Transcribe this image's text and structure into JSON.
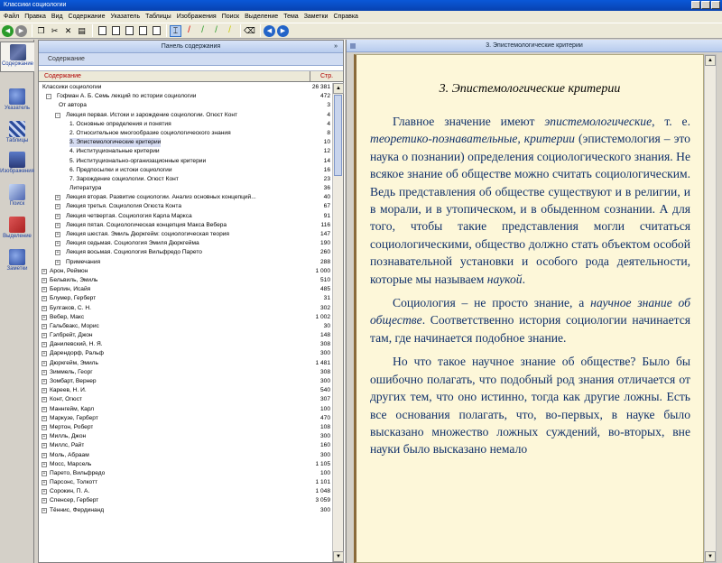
{
  "window": {
    "title": "Классики социологии"
  },
  "menu": [
    "Файл",
    "Правка",
    "Вид",
    "Содержание",
    "Указатель",
    "Таблицы",
    "Изображения",
    "Поиск",
    "Выделение",
    "Тема",
    "Заметки",
    "Справка"
  ],
  "nav": [
    {
      "label": "Содержание",
      "icon": "book-icon",
      "cls": "book",
      "active": true
    },
    {
      "label": "Указатель",
      "icon": "index-icon",
      "cls": "blue",
      "active": false
    },
    {
      "label": "Таблицы",
      "icon": "table-icon",
      "cls": "chk",
      "active": false
    },
    {
      "label": "Изображения",
      "icon": "image-icon",
      "cls": "pic",
      "active": false
    },
    {
      "label": "Поиск",
      "icon": "search-icon",
      "cls": "pen",
      "active": false
    },
    {
      "label": "Выделение",
      "icon": "highlight-icon",
      "cls": "sel",
      "active": false
    },
    {
      "label": "Заметки",
      "icon": "notes-icon",
      "cls": "blue",
      "active": false
    }
  ],
  "contents": {
    "header": "Панель содержания",
    "subheader": "Содержание",
    "col_title": "Содержание",
    "col_page": "Стр.",
    "rows": [
      {
        "t": "Классики социологии",
        "p": "26 381",
        "lvl": 0,
        "exp": ""
      },
      {
        "t": "Гофман А. Б. Семь лекций по истории социологии",
        "p": "472",
        "lvl": 1,
        "exp": "-"
      },
      {
        "t": "От автора",
        "p": "3",
        "lvl": 2,
        "exp": ""
      },
      {
        "t": "Лекция первая. Истоки и зарождение социологии. Огюст Конт",
        "p": "4",
        "lvl": 2,
        "exp": "-"
      },
      {
        "t": "1. Основные определения и понятия",
        "p": "4",
        "lvl": 3,
        "exp": ""
      },
      {
        "t": "2. Относительное многообразие социологического знания",
        "p": "8",
        "lvl": 3,
        "exp": ""
      },
      {
        "t": "3. Эпистемологические критерии",
        "p": "10",
        "lvl": 3,
        "exp": "",
        "hl": true
      },
      {
        "t": "4. Институциональные критерии",
        "p": "12",
        "lvl": 3,
        "exp": ""
      },
      {
        "t": "5. Институционально-организационные критерии",
        "p": "14",
        "lvl": 3,
        "exp": ""
      },
      {
        "t": "6. Предпосылки и истоки социологии",
        "p": "16",
        "lvl": 3,
        "exp": ""
      },
      {
        "t": "7. Зарождение социологии. Огюст Конт",
        "p": "23",
        "lvl": 3,
        "exp": ""
      },
      {
        "t": "Литература",
        "p": "36",
        "lvl": 3,
        "exp": ""
      },
      {
        "t": "Лекция вторая. Развитие социологии. Анализ основных концепций...",
        "p": "40",
        "lvl": 2,
        "exp": "+"
      },
      {
        "t": "Лекция третья. Социология Огюста Конта",
        "p": "67",
        "lvl": 2,
        "exp": "+"
      },
      {
        "t": "Лекция четвертая. Социология Карла Маркса",
        "p": "91",
        "lvl": 2,
        "exp": "+"
      },
      {
        "t": "Лекция пятая. Социологическая концепция Макса Вебера",
        "p": "116",
        "lvl": 2,
        "exp": "+"
      },
      {
        "t": "Лекция шестая. Эмиль Дюркгейм: социологическая теория",
        "p": "147",
        "lvl": 2,
        "exp": "+"
      },
      {
        "t": "Лекция седьмая. Социология Эмиля Дюркгейма",
        "p": "190",
        "lvl": 2,
        "exp": "+"
      },
      {
        "t": "Лекция восьмая. Социология Вильфредо Парето",
        "p": "260",
        "lvl": 2,
        "exp": "+"
      },
      {
        "t": "Примечания",
        "p": "288",
        "lvl": 2,
        "exp": "+"
      },
      {
        "t": "Арон, Реймон",
        "p": "1 000",
        "lvl": 0,
        "exp": "+"
      },
      {
        "t": "Бельвиль, Эмиль",
        "p": "510",
        "lvl": 0,
        "exp": "+"
      },
      {
        "t": "Берлин, Исайя",
        "p": "485",
        "lvl": 0,
        "exp": "+"
      },
      {
        "t": "Блумер, Герберт",
        "p": "31",
        "lvl": 0,
        "exp": "+"
      },
      {
        "t": "Булгаков, С. Н.",
        "p": "302",
        "lvl": 0,
        "exp": "+"
      },
      {
        "t": "Вебер, Макс",
        "p": "1 002",
        "lvl": 0,
        "exp": "+"
      },
      {
        "t": "Гальбвакс, Морис",
        "p": "30",
        "lvl": 0,
        "exp": "+"
      },
      {
        "t": "Гэлбрейт, Джон",
        "p": "148",
        "lvl": 0,
        "exp": "+"
      },
      {
        "t": "Данилевский, Н. Я.",
        "p": "308",
        "lvl": 0,
        "exp": "+"
      },
      {
        "t": "Дарендорф, Ральф",
        "p": "300",
        "lvl": 0,
        "exp": "+"
      },
      {
        "t": "Дюркгейм, Эмиль",
        "p": "1 481",
        "lvl": 0,
        "exp": "+"
      },
      {
        "t": "Зиммель, Георг",
        "p": "308",
        "lvl": 0,
        "exp": "+"
      },
      {
        "t": "Зомбарт, Вернер",
        "p": "300",
        "lvl": 0,
        "exp": "+"
      },
      {
        "t": "Кареев, Н. И.",
        "p": "540",
        "lvl": 0,
        "exp": "+"
      },
      {
        "t": "Конт, Огюст",
        "p": "307",
        "lvl": 0,
        "exp": "+"
      },
      {
        "t": "Маннгейм, Карл",
        "p": "100",
        "lvl": 0,
        "exp": "+"
      },
      {
        "t": "Маркузе, Герберт",
        "p": "470",
        "lvl": 0,
        "exp": "+"
      },
      {
        "t": "Мертон, Роберт",
        "p": "108",
        "lvl": 0,
        "exp": "+"
      },
      {
        "t": "Милль, Джон",
        "p": "300",
        "lvl": 0,
        "exp": "+"
      },
      {
        "t": "Миллс, Райт",
        "p": "160",
        "lvl": 0,
        "exp": "+"
      },
      {
        "t": "Моль, Абраам",
        "p": "300",
        "lvl": 0,
        "exp": "+"
      },
      {
        "t": "Мосс, Марсель",
        "p": "1 105",
        "lvl": 0,
        "exp": "+"
      },
      {
        "t": "Парето, Вильфредо",
        "p": "100",
        "lvl": 0,
        "exp": "+"
      },
      {
        "t": "Парсонс, Толкотт",
        "p": "1 101",
        "lvl": 0,
        "exp": "+"
      },
      {
        "t": "Сорокин, П. А.",
        "p": "1 048",
        "lvl": 0,
        "exp": "+"
      },
      {
        "t": "Спенсер, Герберт",
        "p": "3 059",
        "lvl": 0,
        "exp": "+"
      },
      {
        "t": "Тённис, Фердинанд",
        "p": "300",
        "lvl": 0,
        "exp": "+"
      }
    ]
  },
  "reader": {
    "header": "3. Эпистемологические критерии",
    "title": "3. Эпистемологические критерии",
    "p1": [
      {
        "t": "Главное значение имеют ",
        "i": false
      },
      {
        "t": "эпистемологические",
        "i": true
      },
      {
        "t": ", т. е. ",
        "i": false
      },
      {
        "t": "теоретико-познавательные, критерии",
        "i": true
      },
      {
        "t": " (эпистемология – это наука о познании) определения социологического знания. Не всякое знание об обществе можно считать социологическим. Ведь представления об обществе существуют и в религии, и в морали, и в утопическом, и в обыденном сознании. А для того, чтобы такие представления могли считаться социологическими, общество должно стать объектом особой познавательной установки и особого рода деятельности, которые мы называем ",
        "i": false
      },
      {
        "t": "наукой",
        "i": true
      },
      {
        "t": ".",
        "i": false
      }
    ],
    "p2": [
      {
        "t": "Социология – не просто знание, а ",
        "i": false
      },
      {
        "t": "научное знание об обществе",
        "i": true
      },
      {
        "t": ". Соответственно история социологии начинается там, где начинается подобное знание.",
        "i": false
      }
    ],
    "p3": [
      {
        "t": "Но что такое научное знание об обществе? Было бы ошибочно полагать, что подобный род знания отличается от других тем, что оно истинно, тогда как другие ложны. Есть все основания полагать, что, во-первых, в науке было высказано множество ложных суждений, во-вторых, вне науки было высказано немало",
        "i": false
      }
    ]
  }
}
